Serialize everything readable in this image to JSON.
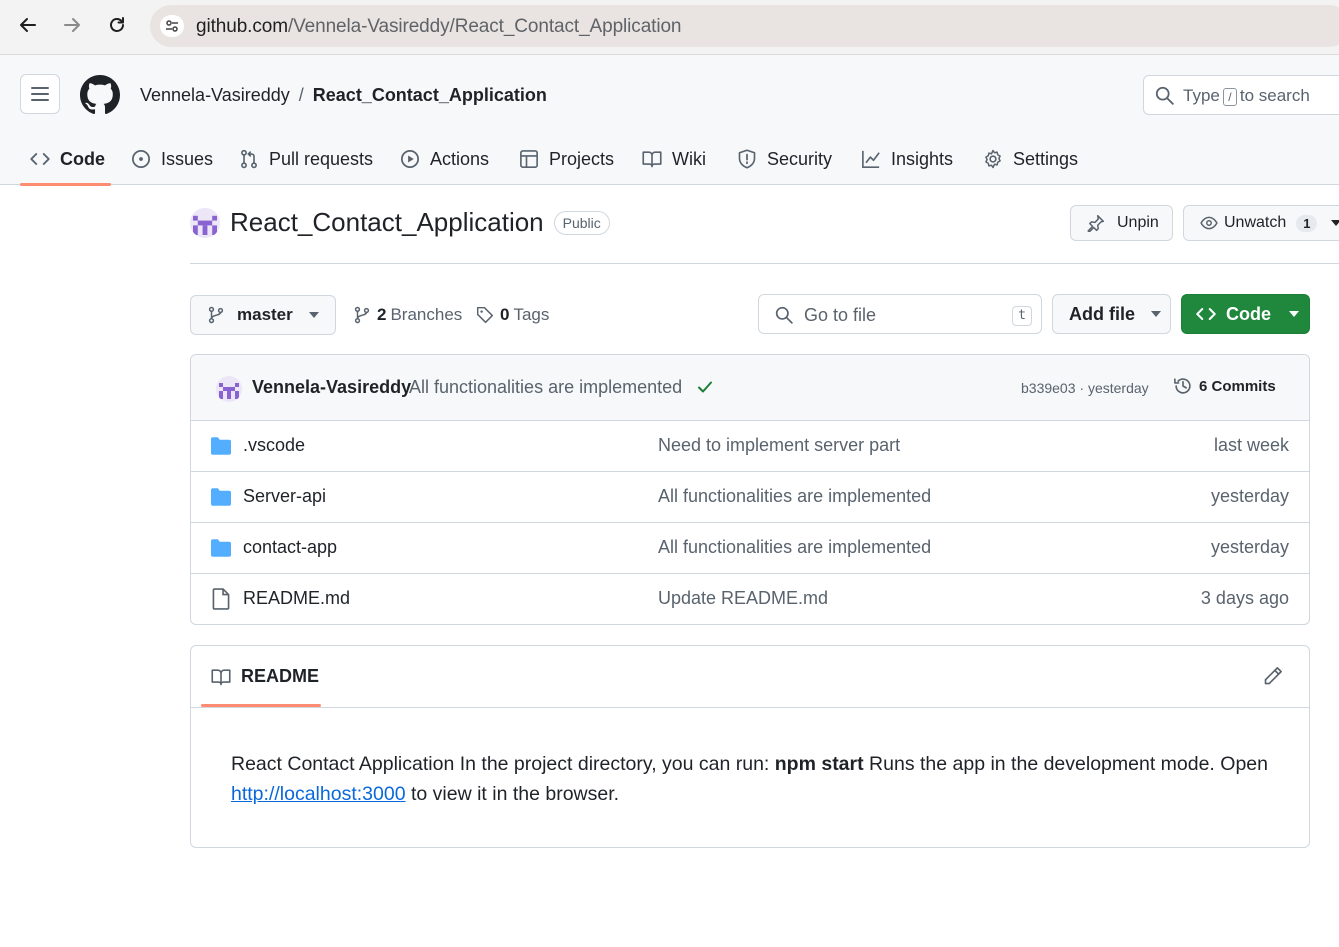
{
  "browser": {
    "url_host": "github.com",
    "url_path": "/Vennela-Vasireddy/React_Contact_Application"
  },
  "header": {
    "owner": "Vennela-Vasireddy",
    "separator": "/",
    "repo": "React_Contact_Application",
    "search_prefix": "Type",
    "search_key": "/",
    "search_suffix": "to search"
  },
  "tabs": [
    {
      "label": "Code",
      "icon": "code-icon"
    },
    {
      "label": "Issues",
      "icon": "issue-icon"
    },
    {
      "label": "Pull requests",
      "icon": "pull-request-icon"
    },
    {
      "label": "Actions",
      "icon": "play-icon"
    },
    {
      "label": "Projects",
      "icon": "table-icon"
    },
    {
      "label": "Wiki",
      "icon": "book-icon"
    },
    {
      "label": "Security",
      "icon": "shield-icon"
    },
    {
      "label": "Insights",
      "icon": "graph-icon"
    },
    {
      "label": "Settings",
      "icon": "gear-icon"
    }
  ],
  "repo": {
    "name": "React_Contact_Application",
    "visibility": "Public",
    "unpin_label": "Unpin",
    "unwatch_label": "Unwatch",
    "watch_count": "1"
  },
  "toolbar": {
    "branch": "master",
    "branches_count": "2",
    "branches_label": "Branches",
    "tags_count": "0",
    "tags_label": "Tags",
    "gofile_placeholder": "Go to file",
    "gofile_key": "t",
    "addfile_label": "Add file",
    "code_label": "Code"
  },
  "commit": {
    "author": "Vennela-Vasireddy",
    "message": "All functionalities are implemented",
    "hash_time": "b339e03 · yesterday",
    "commits_label": "6 Commits"
  },
  "files": [
    {
      "name": ".vscode",
      "type": "folder",
      "message": "Need to implement server part",
      "date": "last week"
    },
    {
      "name": "Server-api",
      "type": "folder",
      "message": "All functionalities are implemented",
      "date": "yesterday"
    },
    {
      "name": "contact-app",
      "type": "folder",
      "message": "All functionalities are implemented",
      "date": "yesterday"
    },
    {
      "name": "README.md",
      "type": "file",
      "message": "Update README.md",
      "date": "3 days ago"
    }
  ],
  "readme": {
    "tab_label": "README",
    "text_1": "React Contact Application In the project directory, you can run: ",
    "bold": "npm start",
    "text_2": " Runs the app in the development mode. Open ",
    "link": "http://localhost:3000",
    "text_3": " to view it in the browser."
  },
  "colors": {
    "accent_underline": "#fd8c73",
    "code_button": "#1f883d",
    "folder": "#54aeff",
    "link": "#0969da",
    "check": "#1a7f37"
  }
}
